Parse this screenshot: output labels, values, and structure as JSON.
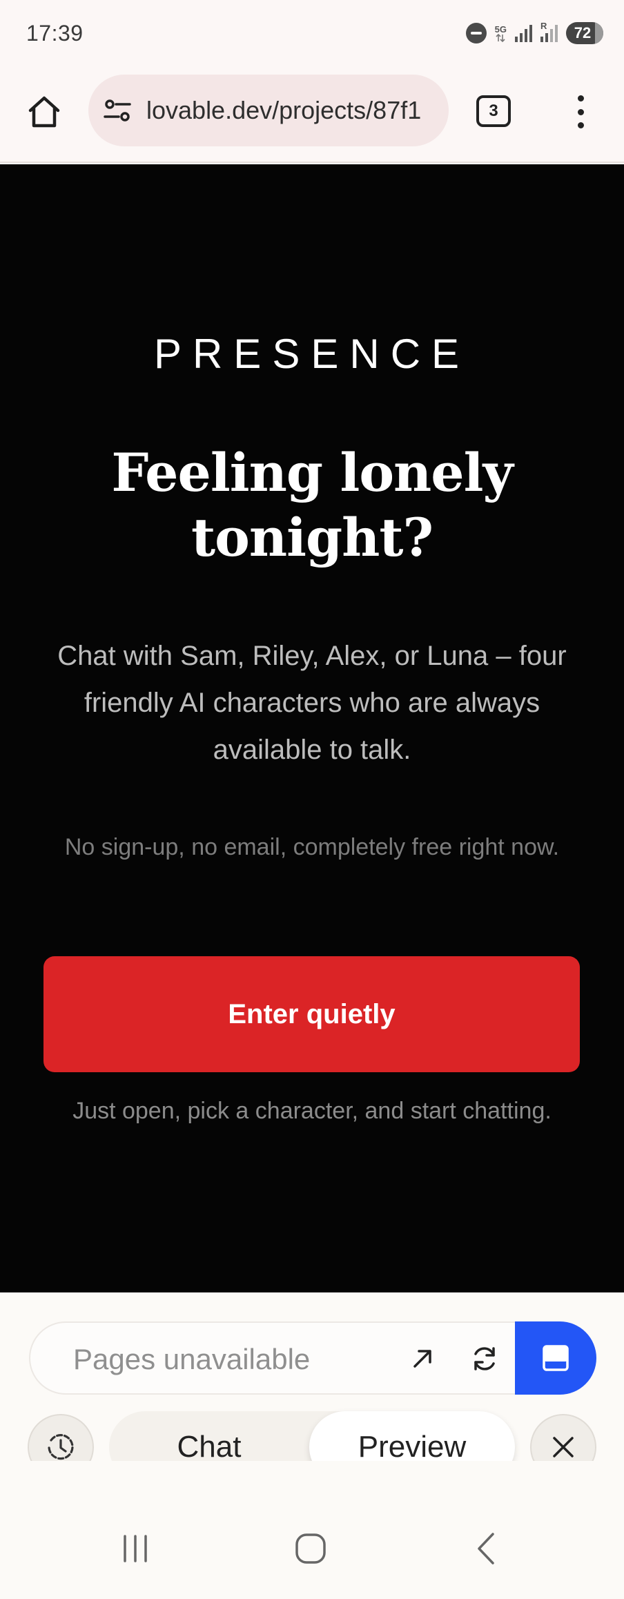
{
  "status_bar": {
    "time": "17:39",
    "network_label": "5G",
    "roaming_label": "R",
    "battery": "72",
    "icons": [
      "dnd-icon",
      "signal-icon",
      "signal-roaming-icon",
      "battery-icon"
    ]
  },
  "browser": {
    "url": "lovable.dev/projects/87f1",
    "tab_count": "3",
    "icons": [
      "home-icon",
      "site-settings-icon",
      "tabs-icon",
      "more-vert-icon"
    ]
  },
  "page": {
    "brand": "PRESENCE",
    "headline": "Feeling lonely tonight?",
    "lead": "Chat with Sam, Riley, Alex, or Luna – four friendly AI characters who are always available to talk.",
    "note": "No sign-up, no email, completely free right now.",
    "cta_label": "Enter quietly",
    "cta_subtext": "Just open, pick a character, and start chatting.",
    "colors": {
      "background": "#050505",
      "cta": "#db2426",
      "text": "#ffffff"
    }
  },
  "panel": {
    "pages_placeholder": "Pages unavailable",
    "tab_chat": "Chat",
    "tab_preview": "Preview",
    "selected_tab": "Preview",
    "accent": "#2356f6",
    "icons": [
      "open-external-icon",
      "refresh-icon",
      "view-mode-icon",
      "history-icon",
      "close-icon"
    ]
  },
  "navbar": {
    "icons": [
      "recents-icon",
      "home-circle-icon",
      "back-icon"
    ]
  }
}
